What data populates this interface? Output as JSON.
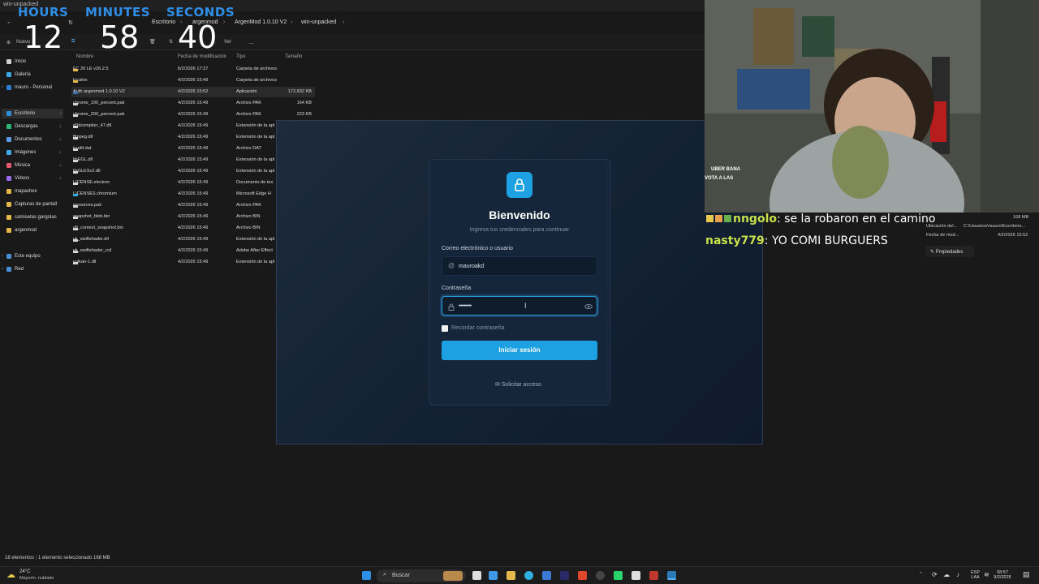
{
  "explorer": {
    "window_title": "win-unpacked",
    "breadcrumbs": [
      "Escritorio",
      "argenmod",
      "ArgenMod 1.0.10 V2",
      "win-unpacked"
    ],
    "toolbar": {
      "new_label": "Nuevo",
      "view_label": "Ver",
      "more_label": "..."
    },
    "nav": [
      {
        "label": "Inicio",
        "color": "#cfcfcf"
      },
      {
        "label": "Galería",
        "color": "#3aa7e6"
      },
      {
        "label": "mauro - Personal",
        "color": "#2d7fd6"
      },
      {
        "label": "Escritorio",
        "color": "#2d8fd6"
      },
      {
        "label": "Descargas",
        "color": "#2bb673"
      },
      {
        "label": "Documentos",
        "color": "#5c9ce6"
      },
      {
        "label": "Imágenes",
        "color": "#3fa9e6"
      },
      {
        "label": "Música",
        "color": "#e6556b"
      },
      {
        "label": "Videos",
        "color": "#9a6ae6"
      },
      {
        "label": "mapashex",
        "color": "#e6b84a"
      },
      {
        "label": "Capturas de pantall",
        "color": "#e6b84a"
      },
      {
        "label": "camisetas gargolas",
        "color": "#e6b84a"
      },
      {
        "label": "argenmod",
        "color": "#e6b84a"
      },
      {
        "label": "Este equipo",
        "color": "#4a8fd6"
      },
      {
        "label": "Red",
        "color": "#4a8fd6"
      }
    ],
    "columns": [
      "Nombre",
      "Fecha de modificación",
      "Tipo",
      "Tamaño"
    ],
    "files": [
      {
        "name": "FC 26 LE v26.2.5",
        "date": "6/2/2026 17:27",
        "type": "Carpeta de archivos",
        "size": "",
        "kind": "folder"
      },
      {
        "name": "locales",
        "date": "4/2/2026 15:49",
        "type": "Carpeta de archivos",
        "size": "",
        "kind": "folder"
      },
      {
        "name": "Auth argenmod 1.0.10 V2",
        "date": "4/2/2026 15:52",
        "type": "Aplicación",
        "size": "172,932 KB",
        "kind": "app"
      },
      {
        "name": "chrome_100_percent.pak",
        "date": "4/2/2026 15:49",
        "type": "Archivo PAK",
        "size": "164 KB",
        "kind": "file"
      },
      {
        "name": "chrome_200_percent.pak",
        "date": "4/2/2026 15:49",
        "type": "Archivo PAK",
        "size": "223 KB",
        "kind": "file"
      },
      {
        "name": "d3dcompiler_47.dll",
        "date": "4/2/2026 15:49",
        "type": "Extensión de la apl",
        "size": "",
        "kind": "file"
      },
      {
        "name": "ffmpeg.dll",
        "date": "4/2/2026 15:49",
        "type": "Extensión de la apl",
        "size": "",
        "kind": "file"
      },
      {
        "name": "icudtl.dat",
        "date": "4/2/2026 15:49",
        "type": "Archivo DAT",
        "size": "",
        "kind": "file"
      },
      {
        "name": "libEGL.dll",
        "date": "4/2/2026 15:49",
        "type": "Extensión de la apl",
        "size": "",
        "kind": "file"
      },
      {
        "name": "libGLESv2.dll",
        "date": "4/2/2026 15:49",
        "type": "Extensión de la apl",
        "size": "",
        "kind": "file"
      },
      {
        "name": "LICENSE.electron",
        "date": "4/2/2026 15:49",
        "type": "Documento de tex",
        "size": "",
        "kind": "file"
      },
      {
        "name": "LICENSES.chromium",
        "date": "4/2/2026 15:49",
        "type": "Microsoft Edge H",
        "size": "",
        "kind": "edge"
      },
      {
        "name": "resources.pak",
        "date": "4/2/2026 15:49",
        "type": "Archivo PAK",
        "size": "",
        "kind": "file"
      },
      {
        "name": "snapshot_blob.bin",
        "date": "4/2/2026 15:49",
        "type": "Archivo BIN",
        "size": "",
        "kind": "file"
      },
      {
        "name": "v8_context_snapshot.bin",
        "date": "4/2/2026 15:49",
        "type": "Archivo BIN",
        "size": "",
        "kind": "file"
      },
      {
        "name": "vk_swiftshader.dll",
        "date": "4/2/2026 15:49",
        "type": "Extensión de la apl",
        "size": "",
        "kind": "file"
      },
      {
        "name": "vk_swiftshader_icd",
        "date": "4/2/2026 15:49",
        "type": "Adobe After Effect",
        "size": "",
        "kind": "file"
      },
      {
        "name": "vulkan-1.dll",
        "date": "4/2/2026 15:49",
        "type": "Extensión de la apl",
        "size": "",
        "kind": "file"
      }
    ],
    "status": {
      "count": "18 elementos",
      "selection": "1 elemento seleccionado 168 MB"
    }
  },
  "clock": {
    "hours_label": "HOURS",
    "minutes_label": "MINUTES",
    "seconds_label": "SECONDS",
    "hours": "12",
    "minutes": "58",
    "seconds": "40"
  },
  "login": {
    "title": "Bienvenido",
    "subtitle": "Ingresa tus credenciales para continuar",
    "user_label": "Correo electrónico o usuario",
    "user_value": "mauroakd",
    "password_label": "Contraseña",
    "password_value": "••••••••",
    "remember_label": "Recordar contraseña",
    "submit_label": "Iniciar sesión",
    "request_label": "Solicitar acceso",
    "accent": "#1da1e2"
  },
  "chat": [
    {
      "user": "nngolo",
      "message": "se la robaron en el camino",
      "color": "#c8e04a"
    },
    {
      "user": "nasty779",
      "message": "YO COMI BURGUERS",
      "color": "#c8e04a"
    }
  ],
  "chat_overlay": {
    "line1": "UBER BANA",
    "line2": "VOTA A LAS"
  },
  "details": {
    "size": "168 MB",
    "location_label": "Ubicación del...",
    "location_value": "C:\\Usuarios\\mauro\\Escritorio...",
    "date_label": "Fecha de mod...",
    "date_value": "4/2/2026 15:52",
    "properties_label": "Propiedades"
  },
  "taskbar": {
    "weather_temp": "24°C",
    "weather_desc": "Mayorm. nublado",
    "search_placeholder": "Buscar",
    "lang_1": "ESP",
    "lang_2": "LAA",
    "time": "08:57",
    "date": "9/2/2026"
  }
}
